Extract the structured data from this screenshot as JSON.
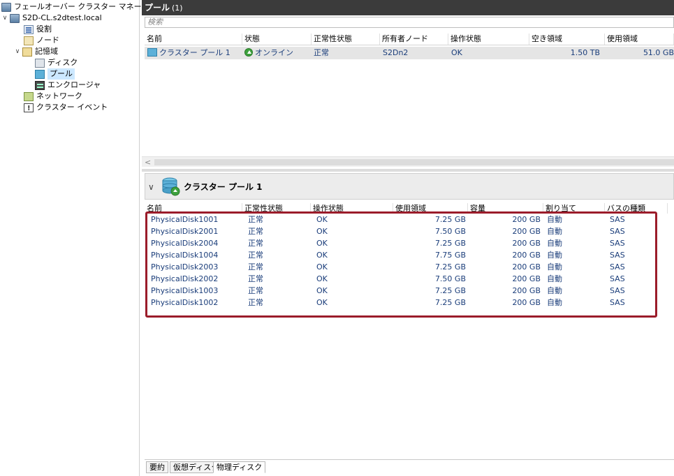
{
  "tree": {
    "root": "フェールオーバー クラスター マネージャー",
    "cluster": "S2D-CL.s2dtest.local",
    "roles": "役割",
    "nodes": "ノード",
    "storage": "記憶域",
    "disks": "ディスク",
    "pools": "プール",
    "enclosures": "エンクロージャ",
    "networks": "ネットワーク",
    "events": "クラスター イベント"
  },
  "pools_panel": {
    "title": "プール",
    "count": "(1)",
    "search_placeholder": "検索",
    "columns": [
      "名前",
      "状態",
      "正常性状態",
      "所有者ノード",
      "操作状態",
      "空き領域",
      "使用領域"
    ],
    "row": {
      "name": "クラスター プール 1",
      "status": "オンライン",
      "health": "正常",
      "owner": "S2Dn2",
      "op_status": "OK",
      "free": "1.50 TB",
      "used": "51.0 GB"
    },
    "scroll_left": "<"
  },
  "detail": {
    "title": "クラスター プール 1",
    "columns": [
      "名前",
      "正常性状態",
      "操作状態",
      "使用領域",
      "容量",
      "割り当て",
      "バスの種類"
    ],
    "disks": [
      {
        "name": "PhysicalDisk1001",
        "health": "正常",
        "op": "OK",
        "used": "7.25 GB",
        "capacity": "200 GB",
        "alloc": "自動",
        "bus": "SAS"
      },
      {
        "name": "PhysicalDisk2001",
        "health": "正常",
        "op": "OK",
        "used": "7.50 GB",
        "capacity": "200 GB",
        "alloc": "自動",
        "bus": "SAS"
      },
      {
        "name": "PhysicalDisk2004",
        "health": "正常",
        "op": "OK",
        "used": "7.25 GB",
        "capacity": "200 GB",
        "alloc": "自動",
        "bus": "SAS"
      },
      {
        "name": "PhysicalDisk1004",
        "health": "正常",
        "op": "OK",
        "used": "7.75 GB",
        "capacity": "200 GB",
        "alloc": "自動",
        "bus": "SAS"
      },
      {
        "name": "PhysicalDisk2003",
        "health": "正常",
        "op": "OK",
        "used": "7.25 GB",
        "capacity": "200 GB",
        "alloc": "自動",
        "bus": "SAS"
      },
      {
        "name": "PhysicalDisk2002",
        "health": "正常",
        "op": "OK",
        "used": "7.50 GB",
        "capacity": "200 GB",
        "alloc": "自動",
        "bus": "SAS"
      },
      {
        "name": "PhysicalDisk1003",
        "health": "正常",
        "op": "OK",
        "used": "7.25 GB",
        "capacity": "200 GB",
        "alloc": "自動",
        "bus": "SAS"
      },
      {
        "name": "PhysicalDisk1002",
        "health": "正常",
        "op": "OK",
        "used": "7.25 GB",
        "capacity": "200 GB",
        "alloc": "自動",
        "bus": "SAS"
      }
    ]
  },
  "tabs": [
    "要約",
    "仮想ディスク",
    "物理ディスク"
  ],
  "colors": {
    "header_bg": "#3b3b3b",
    "highlight": "#9b1c2a",
    "link_text": "#1a3d7a",
    "selected": "#cce8ff"
  }
}
